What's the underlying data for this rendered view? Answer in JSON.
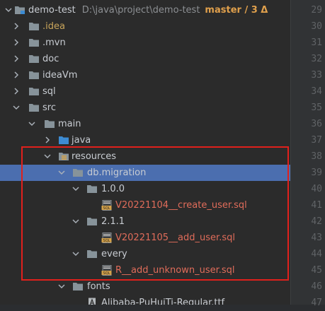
{
  "project": {
    "name": "demo-test",
    "path": "D:\\java\\project\\demo-test",
    "branch": "master / 3 Δ"
  },
  "tree": [
    {
      "label": "demo-test",
      "icon": "module-folder-icon",
      "expanded": true
    },
    {
      "label": ".idea",
      "icon": "folder-icon",
      "expanded": false
    },
    {
      "label": ".mvn",
      "icon": "folder-icon",
      "expanded": false
    },
    {
      "label": "doc",
      "icon": "folder-icon",
      "expanded": false
    },
    {
      "label": "ideaVm",
      "icon": "folder-icon",
      "expanded": false
    },
    {
      "label": "sql",
      "icon": "folder-icon",
      "expanded": false
    },
    {
      "label": "src",
      "icon": "folder-icon",
      "expanded": true
    },
    {
      "label": "main",
      "icon": "folder-icon",
      "expanded": true
    },
    {
      "label": "java",
      "icon": "source-folder-icon",
      "expanded": false
    },
    {
      "label": "resources",
      "icon": "resources-folder-icon",
      "expanded": true
    },
    {
      "label": "db.migration",
      "icon": "folder-icon",
      "expanded": true,
      "selected": true
    },
    {
      "label": "1.0.0",
      "icon": "folder-icon",
      "expanded": true
    },
    {
      "label": "V20221104__create_user.sql",
      "icon": "sql-file-icon"
    },
    {
      "label": "2.1.1",
      "icon": "folder-icon",
      "expanded": true
    },
    {
      "label": "V20221105__add_user.sql",
      "icon": "sql-file-icon"
    },
    {
      "label": "every",
      "icon": "folder-icon",
      "expanded": true
    },
    {
      "label": "R__add_unknown_user.sql",
      "icon": "sql-file-icon"
    },
    {
      "label": "fonts",
      "icon": "folder-icon",
      "expanded": true
    },
    {
      "label": "Alibaba-PuHuiTi-Regular.ttf",
      "icon": "font-file-icon"
    }
  ],
  "line_numbers": [
    "29",
    "30",
    "31",
    "32",
    "33",
    "34",
    "35",
    "36",
    "37",
    "38",
    "39",
    "40",
    "41",
    "42",
    "43",
    "44",
    "45",
    "46",
    "47"
  ],
  "colors": {
    "selection": "#4b6eaf",
    "highlight_box": "#e0201c",
    "sql_file_text": "#e06c5a",
    "ignored_text": "#c9a55b",
    "branch_text": "#e0a04c"
  }
}
